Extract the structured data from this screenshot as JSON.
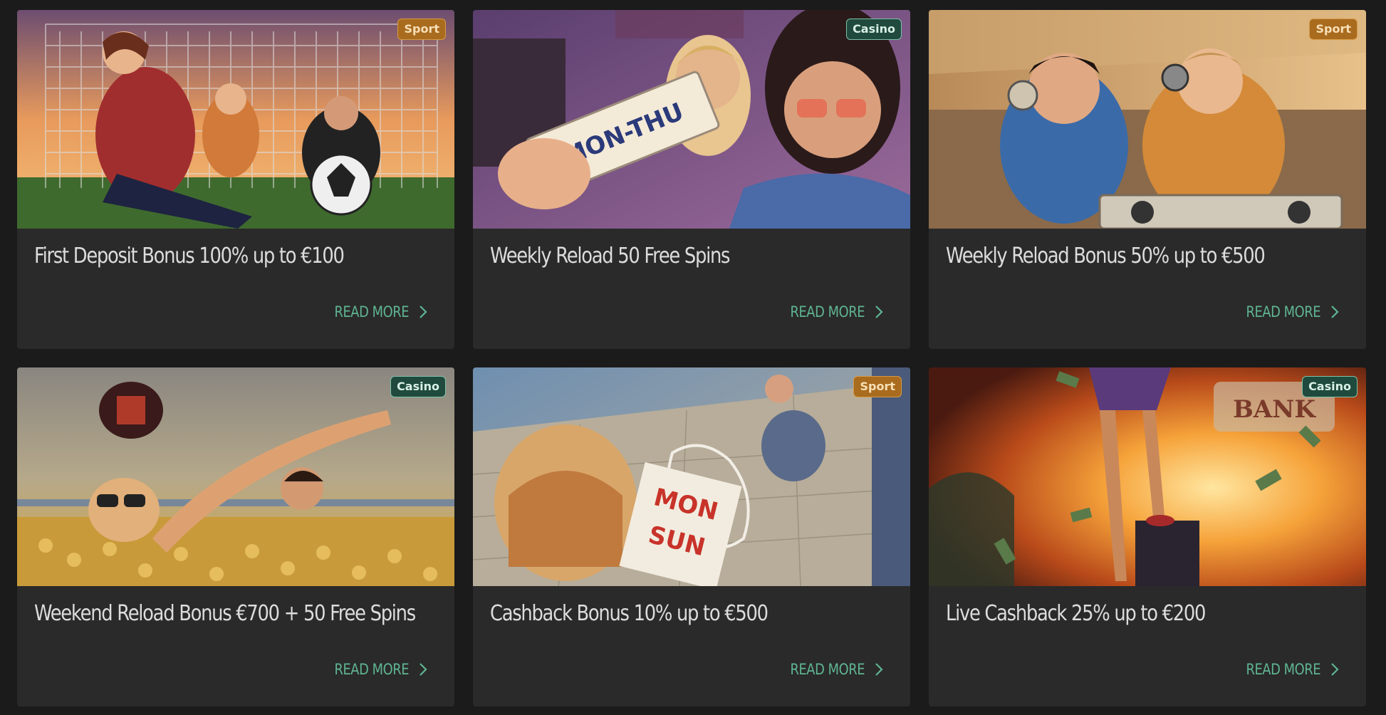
{
  "cards": [
    {
      "badge": "Sport",
      "badge_type": "sport",
      "title": "First Deposit Bonus 100% up to €100",
      "link_label": "READ MORE",
      "image_scene": "soccer-goal-scene",
      "palette": [
        "#e9a35b",
        "#7d4a55",
        "#3e5c2c"
      ]
    },
    {
      "badge": "Casino",
      "badge_type": "casino",
      "title": "Weekly Reload 50 Free Spins",
      "link_label": "READ MORE",
      "image_scene": "casino-ticket-scene",
      "image_text": "MON-THU",
      "palette": [
        "#7a5a8a",
        "#3a2f4d",
        "#c58e6a"
      ]
    },
    {
      "badge": "Sport",
      "badge_type": "sport",
      "title": "Weekly Reload Bonus 50% up to €500",
      "link_label": "READ MORE",
      "image_scene": "headphones-car-scene",
      "palette": [
        "#d4a56a",
        "#6a4a2a",
        "#3d6ba3"
      ]
    },
    {
      "badge": "Casino",
      "badge_type": "casino",
      "title": "Weekend Reload Bonus €700 + 50 Free Spins",
      "link_label": "READ MORE",
      "image_scene": "coin-pool-scene",
      "palette": [
        "#d6a945",
        "#8a8a8a",
        "#c8885a"
      ]
    },
    {
      "badge": "Sport",
      "badge_type": "sport",
      "title": "Cashback Bonus 10% up to €500",
      "link_label": "READ MORE",
      "image_scene": "crime-scene",
      "image_text_1": "MON",
      "image_text_2": "SUN",
      "palette": [
        "#8da3b0",
        "#c97a3e",
        "#4a5a7a"
      ]
    },
    {
      "badge": "Casino",
      "badge_type": "casino",
      "title": "Live Cashback 25% up to €200",
      "link_label": "READ MORE",
      "image_scene": "bank-explosion-scene",
      "image_text": "BANK",
      "palette": [
        "#f2a23a",
        "#a33a18",
        "#2a1a1a"
      ]
    }
  ]
}
